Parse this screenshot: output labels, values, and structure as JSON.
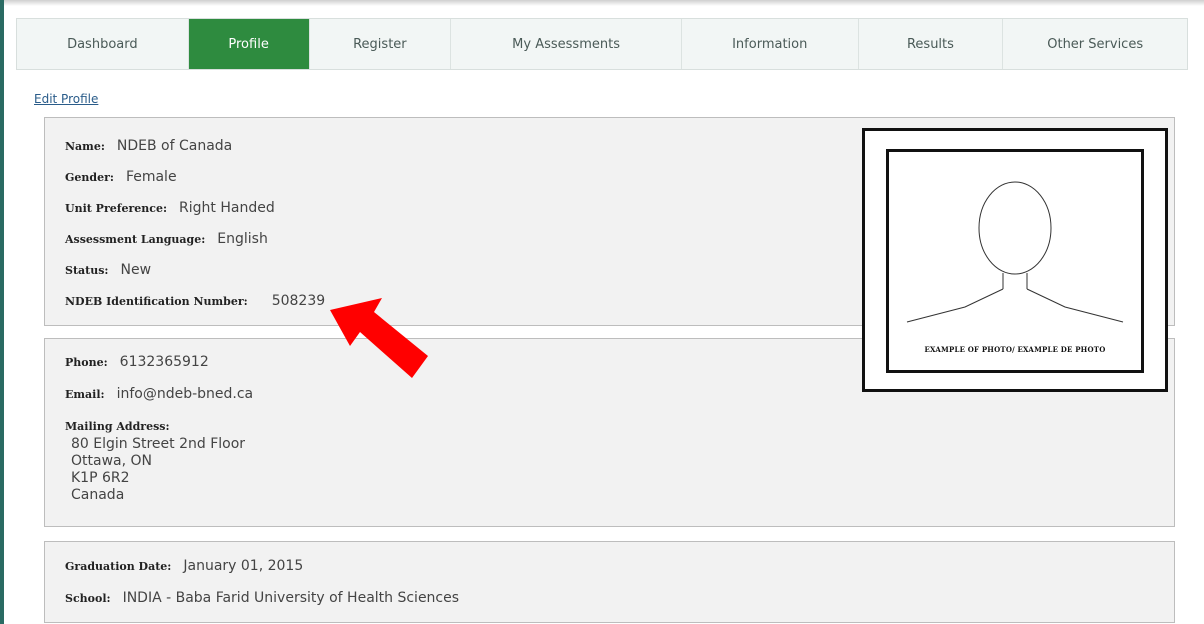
{
  "nav": {
    "items": [
      {
        "label": "Dashboard"
      },
      {
        "label": "Profile",
        "active": true
      },
      {
        "label": "Register"
      },
      {
        "label": "My Assessments"
      },
      {
        "label": "Information"
      },
      {
        "label": "Results"
      },
      {
        "label": "Other Services"
      }
    ]
  },
  "edit_profile_link": "Edit Profile",
  "personal": {
    "name_label": "Name:",
    "name_value": "NDEB of Canada",
    "gender_label": "Gender:",
    "gender_value": "Female",
    "unit_label": "Unit Preference:",
    "unit_value": "Right Handed",
    "language_label": "Assessment Language:",
    "language_value": "English",
    "status_label": "Status:",
    "status_value": "New",
    "ndeb_id_label": "NDEB Identification Number:",
    "ndeb_id_value": "508239"
  },
  "contact": {
    "phone_label": "Phone:",
    "phone_value": "6132365912",
    "email_label": "Email:",
    "email_value": "info@ndeb-bned.ca",
    "mailing_label": "Mailing Address:",
    "address_lines": [
      "80 Elgin Street 2nd Floor",
      "Ottawa, ON",
      "K1P 6R2",
      "Canada"
    ]
  },
  "education": {
    "grad_label": "Graduation Date:",
    "grad_value": "January 01, 2015",
    "school_label": "School:",
    "school_value": "INDIA - Baba Farid University of Health Sciences"
  },
  "photo": {
    "caption": "EXAMPLE OF PHOTO/ EXAMPLE DE PHOTO"
  },
  "colors": {
    "nav_active": "#2e8b3f",
    "annotation_arrow": "#ff0000",
    "left_bar": "#2a6b63"
  }
}
